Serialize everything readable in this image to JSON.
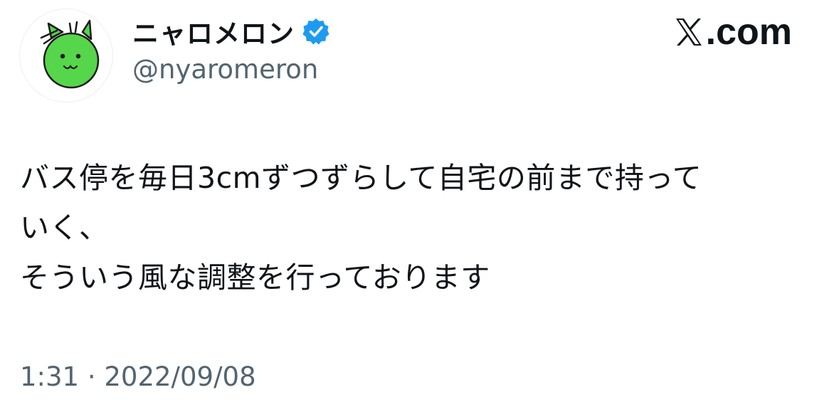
{
  "author": {
    "display_name": "ニャロメロン",
    "handle": "@nyaromeron",
    "verified": true,
    "avatar_icon": "green-cat-face-icon"
  },
  "brand": {
    "label": ".com",
    "icon": "x-logo-icon"
  },
  "tweet": {
    "lines": [
      "バス停を毎日3cmずつずらして自宅の前まで持って",
      "いく、",
      "そういう風な調整を行っております"
    ],
    "timestamp": "1:31 · 2022/09/08"
  },
  "colors": {
    "text_primary": "#0f1419",
    "text_secondary": "#536471",
    "verified_blue": "#1d9bf0",
    "avatar_green": "#56d64a"
  }
}
